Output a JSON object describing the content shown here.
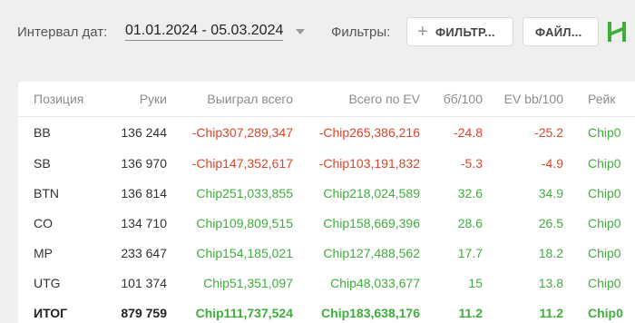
{
  "toolbar": {
    "date_label": "Интервал дат:",
    "date_value": "01.01.2024 - 05.03.2024",
    "filters_label": "Фильтры:",
    "filter_button": "ФИЛЬТР...",
    "file_button": "ФАЙЛ...",
    "plus_icon": "+",
    "logo_icon": "h-logo-icon",
    "accent_color": "#3fae3c"
  },
  "table": {
    "headers": {
      "position": "Позиция",
      "hands": "Руки",
      "won": "Выиграл всего",
      "ev_total": "Всего по EV",
      "bb100": "бб/100",
      "ev_bb100": "EV bb/100",
      "rake": "Рейк"
    },
    "rows": [
      {
        "position": "BB",
        "hands": "136 244",
        "won": "-Chip307,289,347",
        "ev_total": "-Chip265,386,216",
        "bb100": "-24.8",
        "ev_bb100": "-25.2",
        "rake": "Chip0"
      },
      {
        "position": "SB",
        "hands": "136 970",
        "won": "-Chip147,352,617",
        "ev_total": "-Chip103,191,832",
        "bb100": "-5.3",
        "ev_bb100": "-4.9",
        "rake": "Chip0"
      },
      {
        "position": "BTN",
        "hands": "136 814",
        "won": "Chip251,033,855",
        "ev_total": "Chip218,024,589",
        "bb100": "32.6",
        "ev_bb100": "34.9",
        "rake": "Chip0"
      },
      {
        "position": "CO",
        "hands": "134 710",
        "won": "Chip109,809,515",
        "ev_total": "Chip158,669,396",
        "bb100": "28.6",
        "ev_bb100": "26.5",
        "rake": "Chip0"
      },
      {
        "position": "MP",
        "hands": "233 647",
        "won": "Chip154,185,021",
        "ev_total": "Chip127,488,562",
        "bb100": "17.7",
        "ev_bb100": "18.2",
        "rake": "Chip0"
      },
      {
        "position": "UTG",
        "hands": "101 374",
        "won": "Chip51,351,097",
        "ev_total": "Chip48,033,677",
        "bb100": "15",
        "ev_bb100": "13.8",
        "rake": "Chip0"
      }
    ],
    "total": {
      "position": "ИТОГ",
      "hands": "879 759",
      "won": "Chip111,737,524",
      "ev_total": "Chip183,638,176",
      "bb100": "11.2",
      "ev_bb100": "11.2",
      "rake": "Chip0"
    }
  }
}
